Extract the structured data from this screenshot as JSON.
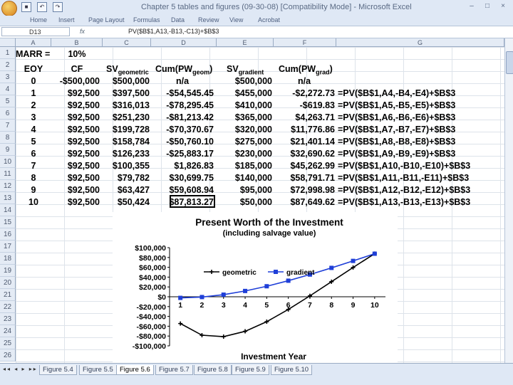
{
  "window": {
    "title": "Chapter 5 tables and figures (09-30-08) [Compatibility Mode] - Microsoft Excel",
    "controls": [
      "–",
      "□",
      "×"
    ]
  },
  "ribbon": {
    "tabs": [
      "Home",
      "Insert",
      "Page Layout",
      "Formulas",
      "Data",
      "Review",
      "View",
      "Acrobat"
    ]
  },
  "formula_bar": {
    "name_box": "D13",
    "fx": "fx",
    "formula": "PV($B$1,A13,-B13,-C13)+$B$3"
  },
  "columns": [
    "A",
    "B",
    "C",
    "D",
    "E",
    "F",
    "G"
  ],
  "rows": [
    "1",
    "2",
    "3",
    "4",
    "5",
    "6",
    "7",
    "8",
    "9",
    "10",
    "11",
    "12",
    "13",
    "14",
    "15",
    "16",
    "17",
    "18",
    "19",
    "20",
    "21",
    "22",
    "23",
    "24",
    "25",
    "26"
  ],
  "sheet": {
    "marr_label": "MARR =",
    "marr_value": "10%",
    "headers": {
      "eoy": "EOY",
      "cf": "CF",
      "sv_geo": "SV",
      "sv_geo_sub": "geometric",
      "cum_geo": "Cum(PW",
      "cum_geo_sub": "geom",
      "cum_geo_close": ")",
      "sv_grad": "SV",
      "sv_grad_sub": "gradient",
      "cum_grad": "Cum(PW",
      "cum_grad_sub": "grad",
      "cum_grad_close": ")"
    },
    "data_rows": [
      {
        "eoy": "0",
        "cf": "-$500,000",
        "svg": "$500,000",
        "cumg": "n/a",
        "svd": "$500,000",
        "cumd": "n/a",
        "formula": ""
      },
      {
        "eoy": "1",
        "cf": "$92,500",
        "svg": "$397,500",
        "cumg": "-$54,545.45",
        "svd": "$455,000",
        "cumd": "-$2,272.73",
        "formula": "=PV($B$1,A4,-B4,-E4)+$B$3"
      },
      {
        "eoy": "2",
        "cf": "$92,500",
        "svg": "$316,013",
        "cumg": "-$78,295.45",
        "svd": "$410,000",
        "cumd": "-$619.83",
        "formula": "=PV($B$1,A5,-B5,-E5)+$B$3"
      },
      {
        "eoy": "3",
        "cf": "$92,500",
        "svg": "$251,230",
        "cumg": "-$81,213.42",
        "svd": "$365,000",
        "cumd": "$4,263.71",
        "formula": "=PV($B$1,A6,-B6,-E6)+$B$3"
      },
      {
        "eoy": "4",
        "cf": "$92,500",
        "svg": "$199,728",
        "cumg": "-$70,370.67",
        "svd": "$320,000",
        "cumd": "$11,776.86",
        "formula": "=PV($B$1,A7,-B7,-E7)+$B$3"
      },
      {
        "eoy": "5",
        "cf": "$92,500",
        "svg": "$158,784",
        "cumg": "-$50,760.10",
        "svd": "$275,000",
        "cumd": "$21,401.14",
        "formula": "=PV($B$1,A8,-B8,-E8)+$B$3"
      },
      {
        "eoy": "6",
        "cf": "$92,500",
        "svg": "$126,233",
        "cumg": "-$25,883.17",
        "svd": "$230,000",
        "cumd": "$32,690.62",
        "formula": "=PV($B$1,A9,-B9,-E9)+$B$3"
      },
      {
        "eoy": "7",
        "cf": "$92,500",
        "svg": "$100,355",
        "cumg": "$1,826.83",
        "svd": "$185,000",
        "cumd": "$45,262.99",
        "formula": "=PV($B$1,A10,-B10,-E10)+$B$3"
      },
      {
        "eoy": "8",
        "cf": "$92,500",
        "svg": "$79,782",
        "cumg": "$30,699.75",
        "svd": "$140,000",
        "cumd": "$58,791.71",
        "formula": "=PV($B$1,A11,-B11,-E11)+$B$3"
      },
      {
        "eoy": "9",
        "cf": "$92,500",
        "svg": "$63,427",
        "cumg": "$59,608.94",
        "svd": "$95,000",
        "cumd": "$72,998.98",
        "formula": "=PV($B$1,A12,-B12,-E12)+$B$3"
      },
      {
        "eoy": "10",
        "cf": "$92,500",
        "svg": "$50,424",
        "cumg": "$87,813.27",
        "svd": "$50,000",
        "cumd": "$87,649.62",
        "formula": "=PV($B$1,A13,-B13,-E13)+$B$3"
      }
    ]
  },
  "sheet_tabs": {
    "nav": "◂◂ ◂ ▸ ▸▸",
    "tabs": [
      "Figure 5.4",
      "Figure 5.5",
      "Figure 5.6",
      "Figure 5.7",
      "Figure 5.8",
      "Figure 5.9",
      "Figure 5.10"
    ],
    "active": "Figure 5.6"
  },
  "chart_data": {
    "type": "line",
    "title": "Present Worth of the Investment",
    "subtitle": "(including salvage value)",
    "xlabel": "Investment Year",
    "ylabel": "",
    "x": [
      1,
      2,
      3,
      4,
      5,
      6,
      7,
      8,
      9,
      10
    ],
    "ylim": [
      -100000,
      100000
    ],
    "yticks": [
      "$100,000",
      "$80,000",
      "$60,000",
      "$40,000",
      "$20,000",
      "$0",
      "-$20,000",
      "-$40,000",
      "-$60,000",
      "-$80,000",
      "-$100,000"
    ],
    "xticks": [
      "1",
      "2",
      "3",
      "4",
      "5",
      "6",
      "7",
      "8",
      "9",
      "10"
    ],
    "series": [
      {
        "name": "geometric",
        "values": [
          -54545.45,
          -78295.45,
          -81213.42,
          -70370.67,
          -50760.1,
          -25883.17,
          1826.83,
          30699.75,
          59608.94,
          87813.27
        ],
        "color": "#000000",
        "marker": "plus"
      },
      {
        "name": "gradient",
        "values": [
          -2272.73,
          -619.83,
          4263.71,
          11776.86,
          21401.14,
          32690.62,
          45262.99,
          58791.71,
          72998.98,
          87649.62
        ],
        "color": "#1f3fd8",
        "marker": "square"
      }
    ],
    "legend_position": "top-left",
    "grid": false
  }
}
